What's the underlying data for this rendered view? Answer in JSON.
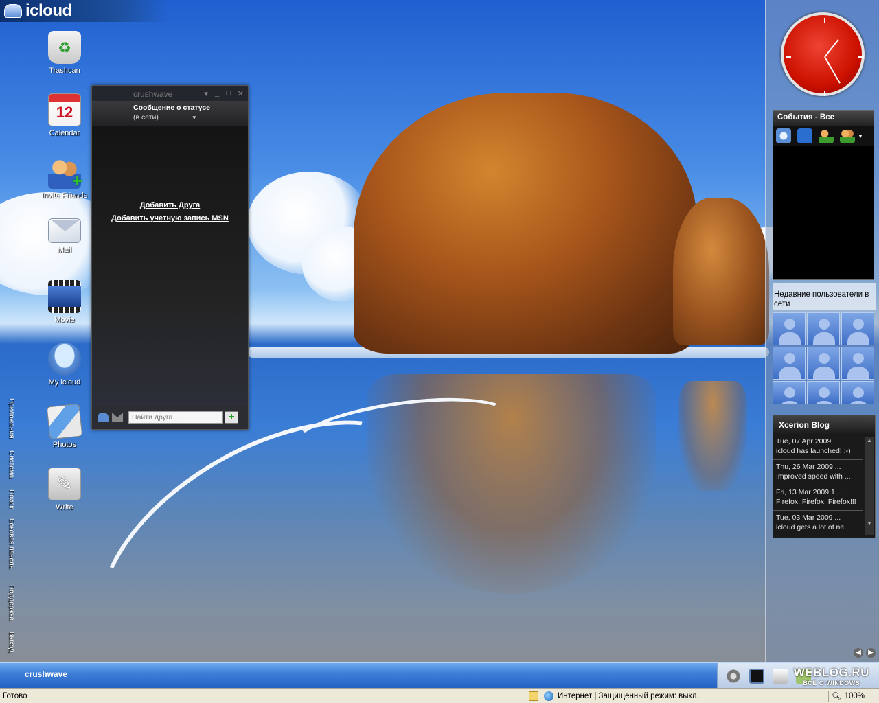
{
  "brand": {
    "name": "icloud"
  },
  "desktop_icons": [
    {
      "label": "Trashcan",
      "icon": "trashcan-icon"
    },
    {
      "label": "Calendar",
      "icon": "calendar-icon"
    },
    {
      "label": "Invite Friends",
      "icon": "invite-friends-icon"
    },
    {
      "label": "Mail",
      "icon": "mail-icon"
    },
    {
      "label": "Movie",
      "icon": "movie-icon"
    },
    {
      "label": "My icloud",
      "icon": "my-icloud-icon"
    },
    {
      "label": "Photos",
      "icon": "photos-icon"
    },
    {
      "label": "Write",
      "icon": "write-icon"
    }
  ],
  "side_menu": [
    "Приложения",
    "Система",
    "Поиск",
    "Боковая панель",
    "Поддержка",
    "Выход"
  ],
  "messenger": {
    "title": "crushwave",
    "status_label": "Сообщение о статусе",
    "status_value": "(в сети)",
    "add_friend": "Добавить Друга",
    "add_msn": "Добавить учетную запись MSN",
    "search_placeholder": "Найти друга...",
    "add_button": "+"
  },
  "sidebar": {
    "events_title": "События - Все",
    "users_title": "Недавние пользователи в сети",
    "blog_title": "Xcerion Blog",
    "blog_items": [
      {
        "date": "Tue, 07 Apr 2009 ...",
        "text": "icloud has launched! :-)"
      },
      {
        "date": "Thu, 26 Mar 2009 ...",
        "text": "Improved speed with ..."
      },
      {
        "date": "Fri, 13 Mar 2009 1...",
        "text": "Firefox, Firefox, Firefox!!!"
      },
      {
        "date": "Tue, 03 Mar 2009 ...",
        "text": "icloud gets a lot of ne..."
      }
    ]
  },
  "taskbar": {
    "user": "crushwave",
    "watermark_1": "WEBLOG.RU",
    "watermark_2": "ВСЁ О WINDOWS"
  },
  "statusbar": {
    "ready": "Готово",
    "zone": "Интернет | Защищенный режим: выкл.",
    "zoom": "100%"
  },
  "colors": {
    "taskbar": "#3f7fd8",
    "clock_face": "#cc1100",
    "messenger_bg": "#232326"
  }
}
